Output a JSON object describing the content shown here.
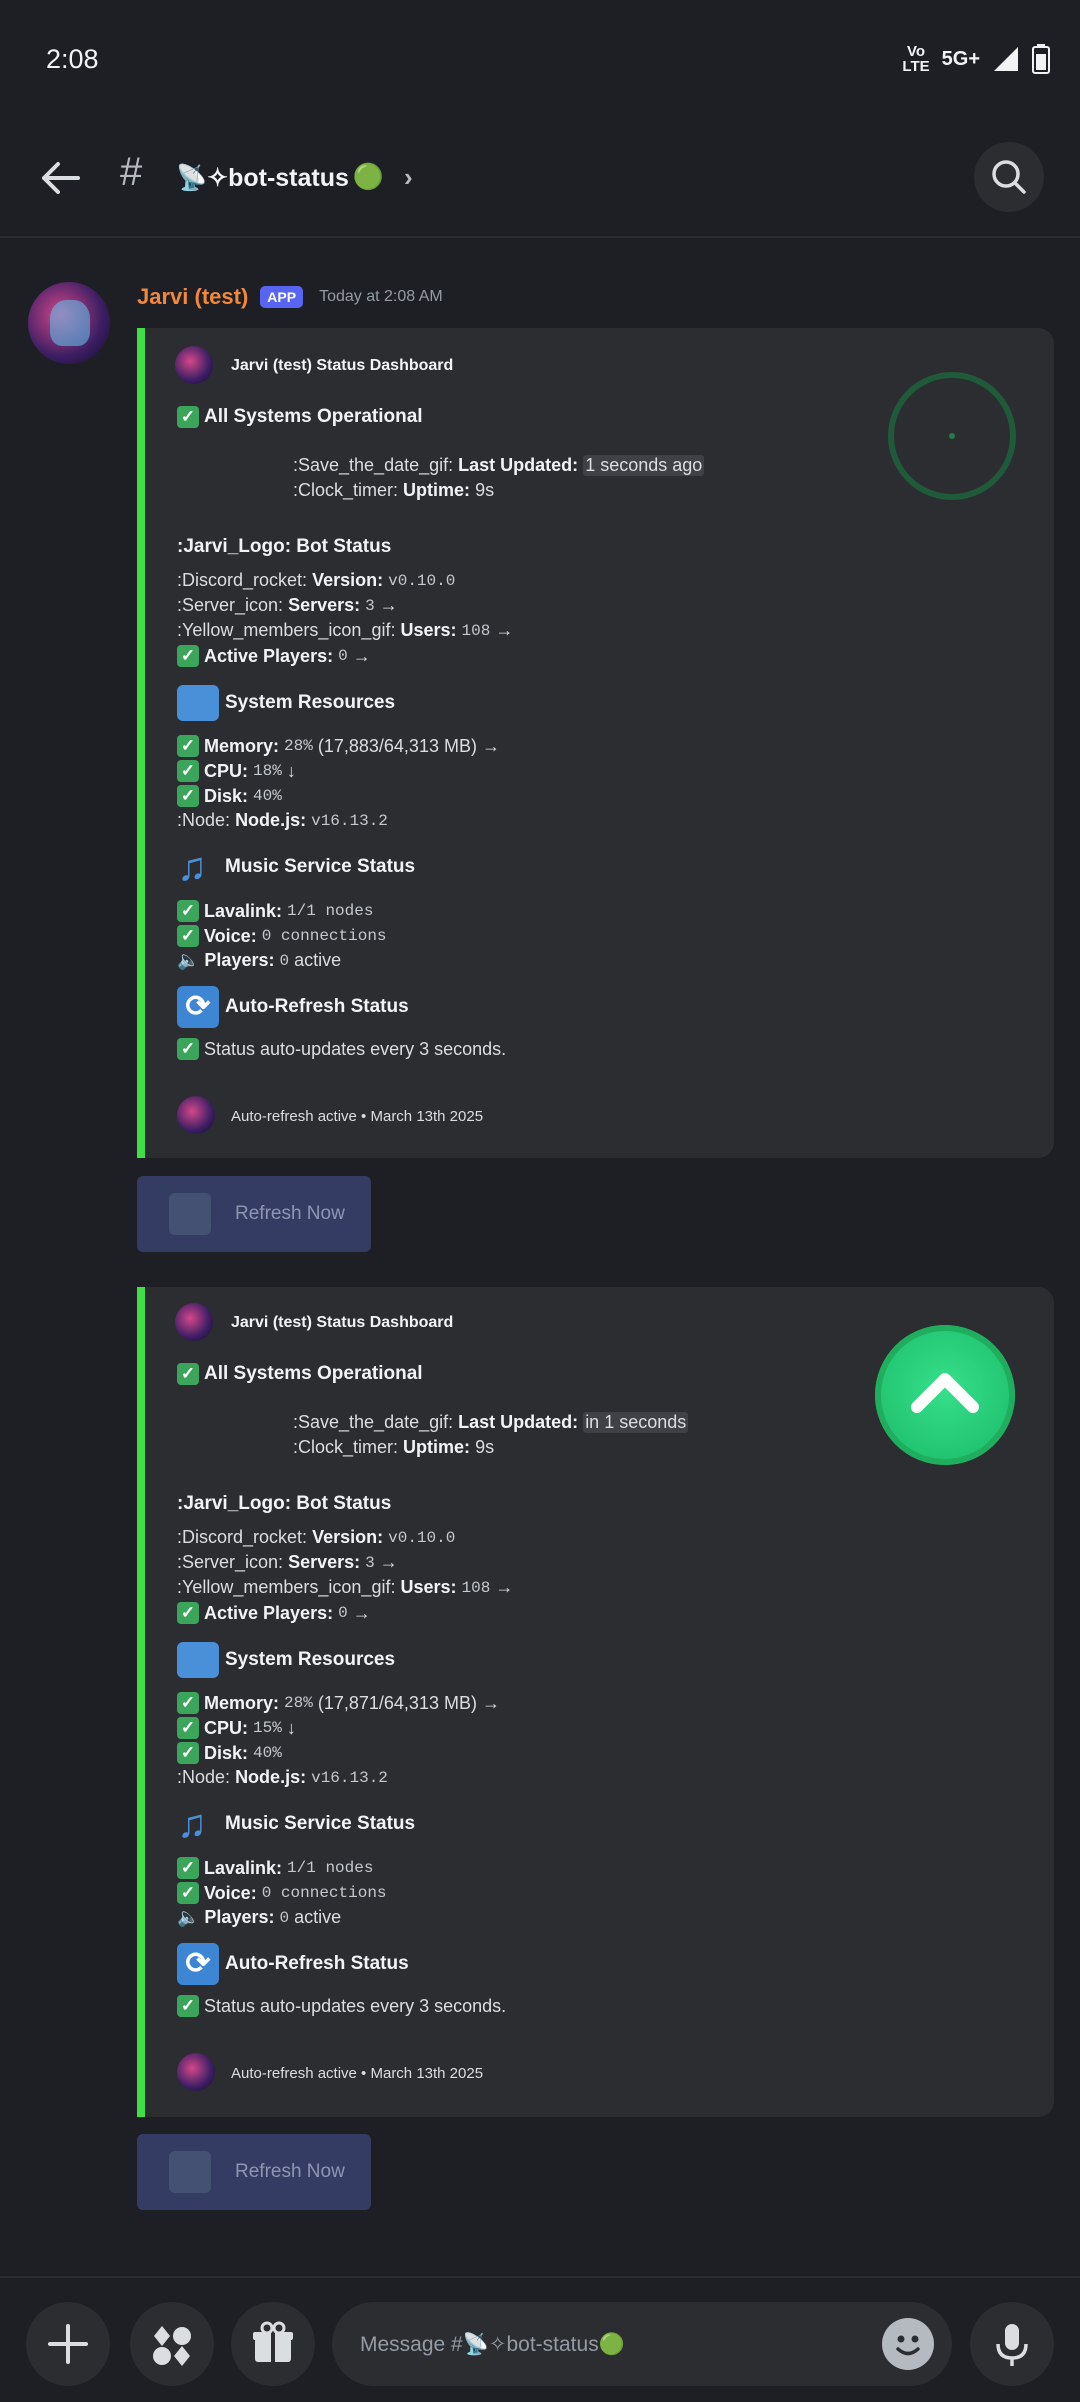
{
  "status_bar": {
    "time": "2:08",
    "volte_top": "Vo",
    "volte_mid": "LTE",
    "network": "5G+"
  },
  "header": {
    "hash": "#",
    "channel": "📡✧bot-status",
    "channel_dot": "🟢",
    "chevron": "›"
  },
  "message": {
    "author": "Jarvi (test)",
    "badge": "APP",
    "timestamp": "Today at 2:08 AM"
  },
  "embeds": [
    {
      "author": "Jarvi (test) Status Dashboard",
      "headline": "All Systems Operational",
      "last_updated_label": ":Save_the_date_gif:",
      "last_updated_key": "Last Updated:",
      "last_updated_value": "1 seconds ago",
      "uptime_label": ":Clock_timer:",
      "uptime_key": "Uptime:",
      "uptime_value": "9s",
      "bot_status_title": ":Jarvi_Logo: Bot Status",
      "version_label": ":Discord_rocket:",
      "version_key": "Version:",
      "version_value": "v0.10.0",
      "servers_label": ":Server_icon:",
      "servers_key": "Servers:",
      "servers_value": "3",
      "users_label": ":Yellow_members_icon_gif:",
      "users_key": "Users:",
      "users_value": "108",
      "active_players_key": "Active Players:",
      "active_players_value": "0",
      "system_title": "System Resources",
      "memory_key": "Memory:",
      "memory_pct": "28%",
      "memory_detail": "(17,883/64,313 MB)",
      "cpu_key": "CPU:",
      "cpu_value": "18%",
      "disk_key": "Disk:",
      "disk_value": "40%",
      "node_label": ":Node:",
      "node_key": "Node.js:",
      "node_value": "v16.13.2",
      "music_title": "Music Service Status",
      "lavalink_key": "Lavalink:",
      "lavalink_value": "1/1 nodes",
      "voice_key": "Voice:",
      "voice_value": "0 connections",
      "players_key": "Players:",
      "players_num": "0",
      "players_suffix": "active",
      "refresh_title": "Auto-Refresh Status",
      "refresh_text": "Status auto-updates every 3 seconds.",
      "footer": "Auto-refresh active • March 13th 2025"
    },
    {
      "author": "Jarvi (test) Status Dashboard",
      "headline": "All Systems Operational",
      "last_updated_label": ":Save_the_date_gif:",
      "last_updated_key": "Last Updated:",
      "last_updated_value": "in 1 seconds",
      "uptime_label": ":Clock_timer:",
      "uptime_key": "Uptime:",
      "uptime_value": "9s",
      "bot_status_title": ":Jarvi_Logo: Bot Status",
      "version_label": ":Discord_rocket:",
      "version_key": "Version:",
      "version_value": "v0.10.0",
      "servers_label": ":Server_icon:",
      "servers_key": "Servers:",
      "servers_value": "3",
      "users_label": ":Yellow_members_icon_gif:",
      "users_key": "Users:",
      "users_value": "108",
      "active_players_key": "Active Players:",
      "active_players_value": "0",
      "system_title": "System Resources",
      "memory_key": "Memory:",
      "memory_pct": "28%",
      "memory_detail": "(17,871/64,313 MB)",
      "cpu_key": "CPU:",
      "cpu_value": "15%",
      "disk_key": "Disk:",
      "disk_value": "40%",
      "node_label": ":Node:",
      "node_key": "Node.js:",
      "node_value": "v16.13.2",
      "music_title": "Music Service Status",
      "lavalink_key": "Lavalink:",
      "lavalink_value": "1/1 nodes",
      "voice_key": "Voice:",
      "voice_value": "0 connections",
      "players_key": "Players:",
      "players_num": "0",
      "players_suffix": "active",
      "refresh_title": "Auto-Refresh Status",
      "refresh_text": "Status auto-updates every 3 seconds.",
      "footer": "Auto-refresh active • March 13th 2025"
    }
  ],
  "refresh_button_label": "Refresh Now",
  "composer": {
    "placeholder_prefix": "Message #",
    "placeholder_channel": "📡✧bot-status",
    "placeholder_dot": "🟢"
  },
  "icons": {
    "back": "back-arrow-icon",
    "search": "search-icon",
    "plus": "plus-icon",
    "apps": "apps-icon",
    "gift": "gift-icon",
    "emoji": "emoji-icon",
    "mic": "microphone-icon",
    "check": "check-mark-icon",
    "laptop": "laptop-icon",
    "music": "music-note-icon",
    "refresh": "refresh-icon",
    "speaker": "speaker-icon"
  },
  "colors": {
    "accent_green": "#3ee046",
    "author_orange": "#f0883e",
    "badge_blurple": "#5865f2"
  }
}
